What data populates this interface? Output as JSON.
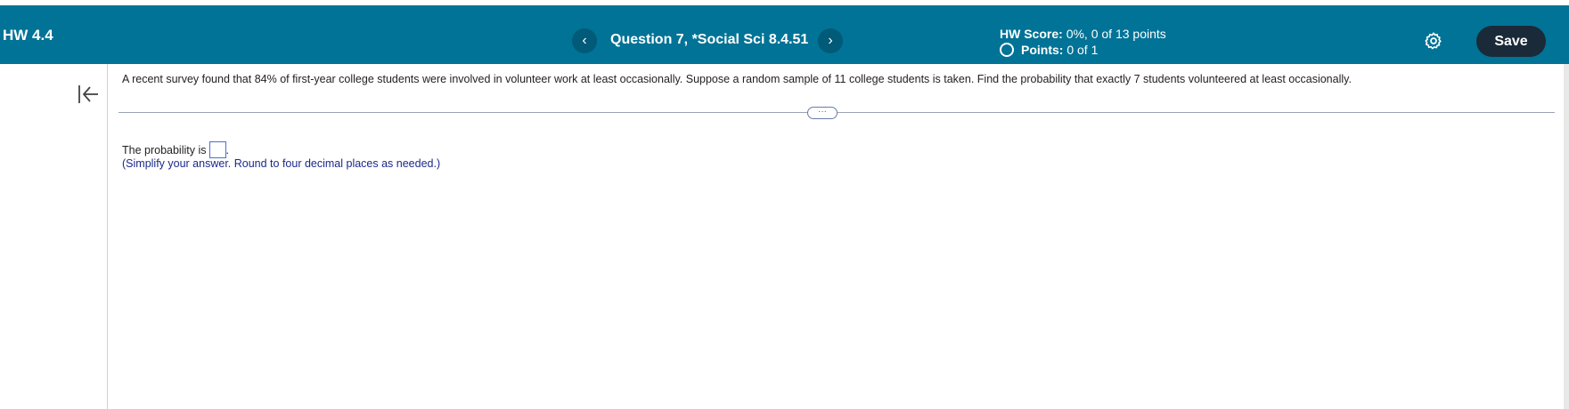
{
  "header": {
    "hw_title": "HW 4.4",
    "prev_label": "‹",
    "next_label": "›",
    "question_title": "Question 7, *Social Sci 8.4.51",
    "hw_score_label": "HW Score:",
    "hw_score_value": "0%, 0 of 13 points",
    "points_label": "Points:",
    "points_value": "0 of 1",
    "save_label": "Save"
  },
  "question": {
    "text": "A recent survey found that 84% of first-year college students were involved in volunteer work at least occasionally. Suppose a random sample of 11 college students is taken. Find the probability that exactly 7 students volunteered at least occasionally.",
    "divider_label": "···",
    "answer_prefix": "The probability is",
    "answer_value": "",
    "answer_suffix": ".",
    "hint": "(Simplify your answer. Round to four decimal places as needed.)"
  },
  "colors": {
    "header_bg": "#007396",
    "save_bg": "#1b2a38",
    "hint_text": "#1a2a8a"
  }
}
